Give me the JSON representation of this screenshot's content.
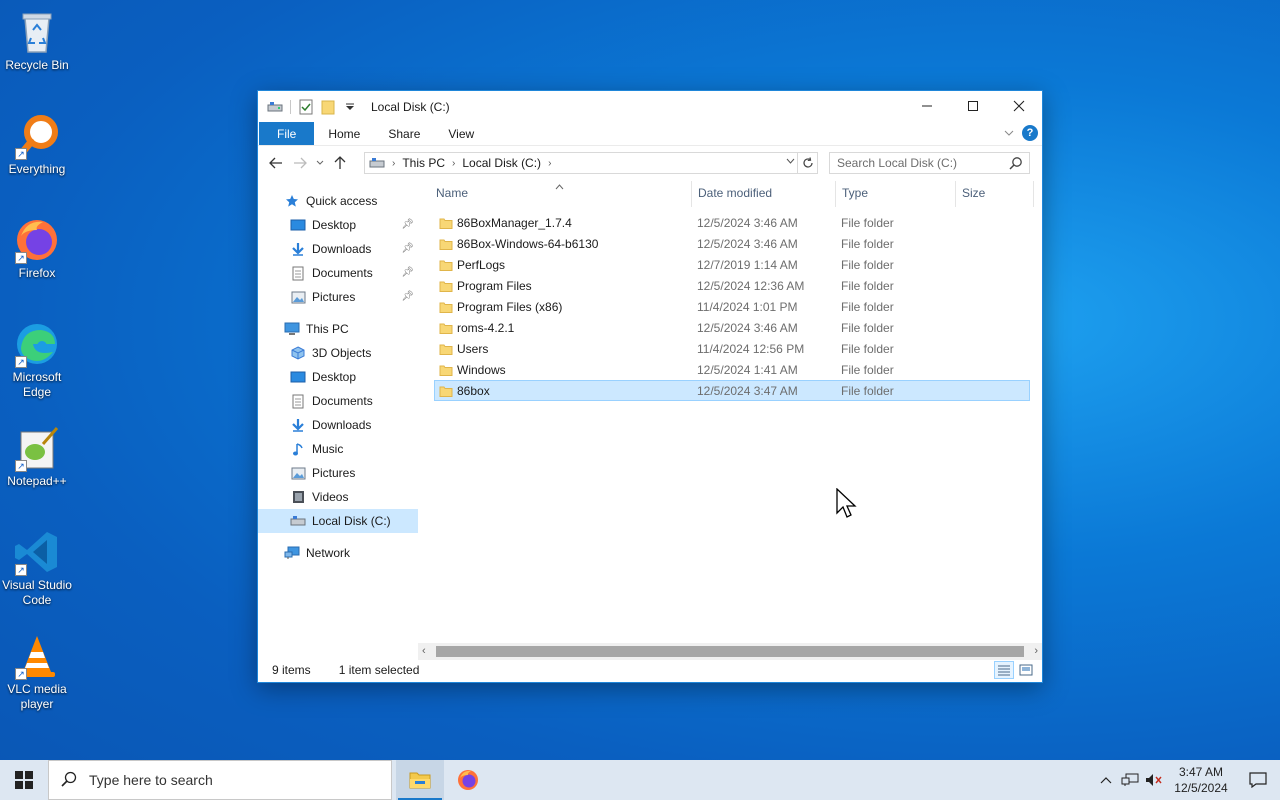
{
  "desktop": {
    "icons": [
      {
        "label": "Recycle Bin",
        "icon": "recycle-bin-icon"
      },
      {
        "label": "Everything",
        "icon": "everything-search-icon"
      },
      {
        "label": "Firefox",
        "icon": "firefox-icon"
      },
      {
        "label": "Microsoft Edge",
        "icon": "edge-icon"
      },
      {
        "label": "Notepad++",
        "icon": "notepadpp-icon"
      },
      {
        "label": "Visual Studio Code",
        "icon": "vscode-icon"
      },
      {
        "label": "VLC media player",
        "icon": "vlc-icon"
      }
    ]
  },
  "window": {
    "title": "Local Disk (C:)",
    "ribbon_tabs": [
      "File",
      "Home",
      "Share",
      "View"
    ],
    "address": {
      "segments": [
        "This PC",
        "Local Disk (C:)"
      ]
    },
    "search_placeholder": "Search Local Disk (C:)",
    "nav": {
      "quick_access": "Quick access",
      "quick_items": [
        "Desktop",
        "Downloads",
        "Documents",
        "Pictures"
      ],
      "this_pc": "This PC",
      "pc_items": [
        "3D Objects",
        "Desktop",
        "Documents",
        "Downloads",
        "Music",
        "Pictures",
        "Videos",
        "Local Disk (C:)"
      ],
      "network": "Network"
    },
    "columns": [
      "Name",
      "Date modified",
      "Type",
      "Size"
    ],
    "files": [
      {
        "name": "86BoxManager_1.7.4",
        "date": "12/5/2024 3:46 AM",
        "type": "File folder"
      },
      {
        "name": "86Box-Windows-64-b6130",
        "date": "12/5/2024 3:46 AM",
        "type": "File folder"
      },
      {
        "name": "PerfLogs",
        "date": "12/7/2019 1:14 AM",
        "type": "File folder"
      },
      {
        "name": "Program Files",
        "date": "12/5/2024 12:36 AM",
        "type": "File folder"
      },
      {
        "name": "Program Files (x86)",
        "date": "11/4/2024 1:01 PM",
        "type": "File folder"
      },
      {
        "name": "roms-4.2.1",
        "date": "12/5/2024 3:46 AM",
        "type": "File folder"
      },
      {
        "name": "Users",
        "date": "11/4/2024 12:56 PM",
        "type": "File folder"
      },
      {
        "name": "Windows",
        "date": "12/5/2024 1:41 AM",
        "type": "File folder"
      },
      {
        "name": "86box",
        "date": "12/5/2024 3:47 AM",
        "type": "File folder",
        "selected": true
      }
    ],
    "status": {
      "count": "9 items",
      "selection": "1 item selected"
    }
  },
  "taskbar": {
    "search_placeholder": "Type here to search",
    "time": "3:47 AM",
    "date": "12/5/2024"
  },
  "colors": {
    "accent": "#1979ca",
    "selection": "#cce8ff",
    "folder": "#f8d775"
  }
}
